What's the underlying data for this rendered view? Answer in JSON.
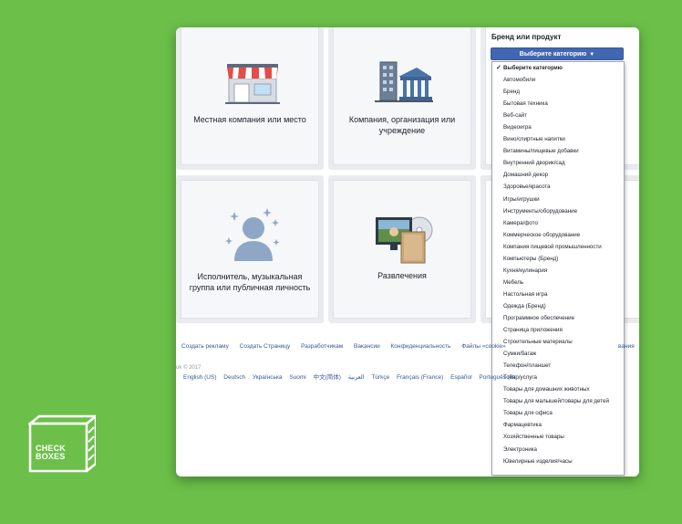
{
  "tiles": [
    {
      "label": "Местная компания или место",
      "icon": "storefront-icon"
    },
    {
      "label": "Компания, организация или учреждение",
      "icon": "buildings-icon"
    },
    {
      "label": "Исполнитель, музыкальная группа или публичная личность",
      "icon": "person-silhouette-icon"
    },
    {
      "label": "Развлечения",
      "icon": "tv-media-icon"
    }
  ],
  "brand": {
    "title": "Бренд или продукт",
    "select_label": "Выберите категорию",
    "options": [
      "Выберите категорию",
      "Автомобили",
      "Бренд",
      "Бытовая техника",
      "Веб-сайт",
      "Видеоигра",
      "Вино/спиртные напитки",
      "Витамины/пищевые добавки",
      "Внутренний дворик/сад",
      "Домашний декор",
      "Здоровье/красота",
      "Игры/игрушки",
      "Инструменты/оборудование",
      "Камера/фото",
      "Коммерческое оборудование",
      "Компания пищевой промышленности",
      "Компьютеры (Бренд)",
      "Кухня/кулинария",
      "Мебель",
      "Настольная игра",
      "Одежда (Бренд)",
      "Программное обеспечение",
      "Страница приложения",
      "Строительные материалы",
      "Сумки/багаж",
      "Телефон/планшет",
      "Товар/услуга",
      "Товары для домашних животных",
      "Товары для малышей/товары для детей",
      "Товары для офиса",
      "Фармацевтика",
      "Хозяйственные товары",
      "Электроника",
      "Ювелирные изделия/часы"
    ],
    "selected_index": 0
  },
  "footer": {
    "links": [
      "Создать рекламу",
      "Создать Страницу",
      "Разработчикам",
      "Вакансии",
      "Конфиденциальность",
      "Файлы «cookie»"
    ],
    "trailing": "вания",
    "copyright": "ok © 2017",
    "languages": [
      "English (US)",
      "Deutsch",
      "Українська",
      "Suomi",
      "中文(简体)",
      "العربية",
      "Türkçe",
      "Français (France)",
      "Español",
      "Português (Br"
    ]
  },
  "logo": {
    "line1": "CHECK",
    "line2": "BOXES"
  },
  "colors": {
    "background": "#6cc04a",
    "button": "#4267b2",
    "link": "#365899"
  }
}
